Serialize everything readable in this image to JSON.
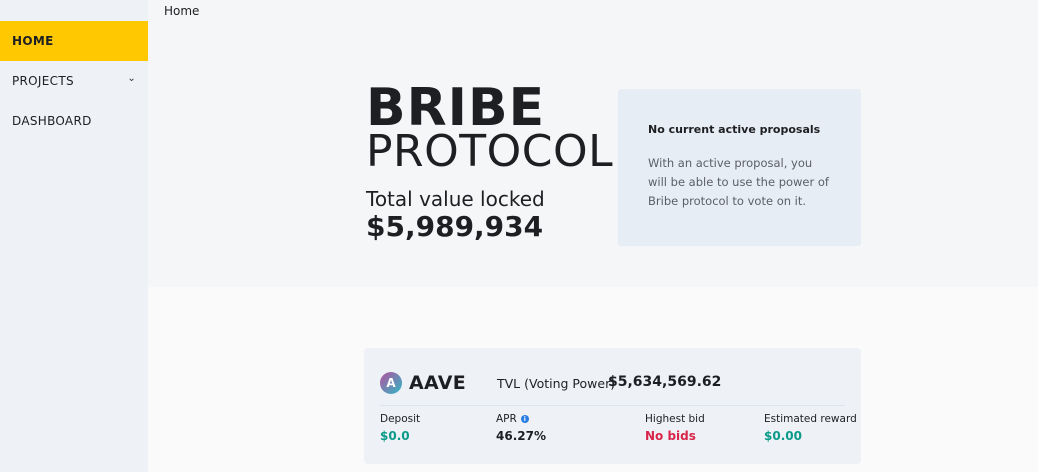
{
  "breadcrumb": "Home",
  "sidebar": {
    "items": [
      {
        "label": "HOME",
        "active": true
      },
      {
        "label": "PROJECTS",
        "active": false
      },
      {
        "label": "DASHBOARD",
        "active": false
      }
    ]
  },
  "hero": {
    "brand_main": "BRIBE",
    "brand_sub": "PROTOCOL",
    "tvl_label": "Total value locked",
    "tvl_value": "$5,989,934"
  },
  "proposals": {
    "title": "No current active proposals",
    "text": "With an active proposal, you will be able to use the power of Bribe protocol to vote on it."
  },
  "project": {
    "name": "AAVE",
    "logo_glyph": "A",
    "voting_label": "TVL (Voting Power)",
    "voting_value": "$5,634,569.62",
    "stats": {
      "deposit_label": "Deposit",
      "deposit_value": "$0.0",
      "apr_label": "APR",
      "apr_value": "46.27%",
      "bid_label": "Highest bid",
      "bid_value": "No bids",
      "reward_label": "Estimated reward",
      "reward_value": "$0.00"
    }
  },
  "colors": {
    "accent": "#ffc800",
    "positive": "#0a9a8a",
    "negative": "#d9254a"
  }
}
